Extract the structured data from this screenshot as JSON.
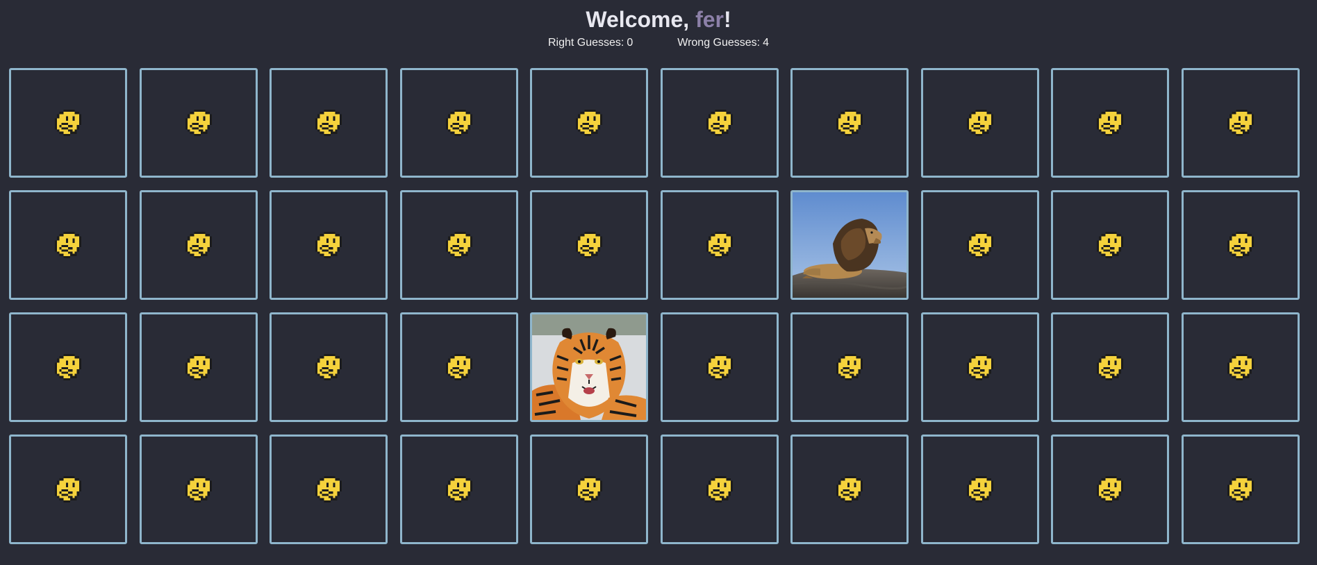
{
  "header": {
    "welcome_prefix": "Welcome, ",
    "username": "fer",
    "welcome_suffix": "!"
  },
  "stats": {
    "right_label": "Right Guesses:",
    "right_value": "0",
    "wrong_label": "Wrong Guesses:",
    "wrong_value": "4"
  },
  "board": {
    "columns": 10,
    "rows": 4,
    "hidden_icon": "thinking-face-icon",
    "revealed": [
      {
        "index": 16,
        "image": "lion"
      },
      {
        "index": 24,
        "image": "tiger"
      }
    ]
  },
  "colors": {
    "background": "#292b36",
    "card_border": "#8fb6cc",
    "username": "#8c80a8",
    "face": "#f5d23c"
  }
}
